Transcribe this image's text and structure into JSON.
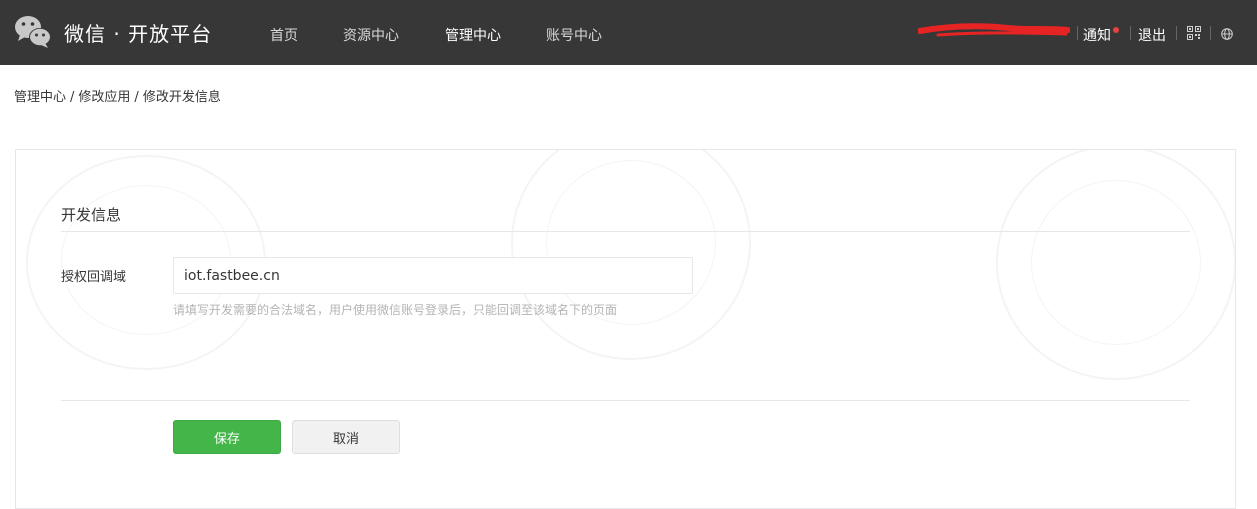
{
  "header": {
    "brand": "微信 · 开放平台",
    "nav": [
      {
        "label": "首页",
        "active": false
      },
      {
        "label": "资源中心",
        "active": false
      },
      {
        "label": "管理中心",
        "active": true
      },
      {
        "label": "账号中心",
        "active": false
      }
    ],
    "notify_label": "通知",
    "logout_label": "退出",
    "icons": [
      "wechat-logo-icon",
      "qrcode-icon",
      "globe-icon"
    ],
    "colors": {
      "bar": "#373737",
      "badge": "#e64340",
      "redaction": "#e62424"
    }
  },
  "breadcrumb": [
    "管理中心",
    "修改应用",
    "修改开发信息"
  ],
  "form": {
    "section_title": "开发信息",
    "domain_label": "授权回调域",
    "domain_value": "iot.fastbee.cn",
    "domain_tip": "请填写开发需要的合法域名，用户使用微信账号登录后，只能回调至该域名下的页面",
    "save_label": "保存",
    "cancel_label": "取消",
    "colors": {
      "primary": "#44b549"
    }
  }
}
